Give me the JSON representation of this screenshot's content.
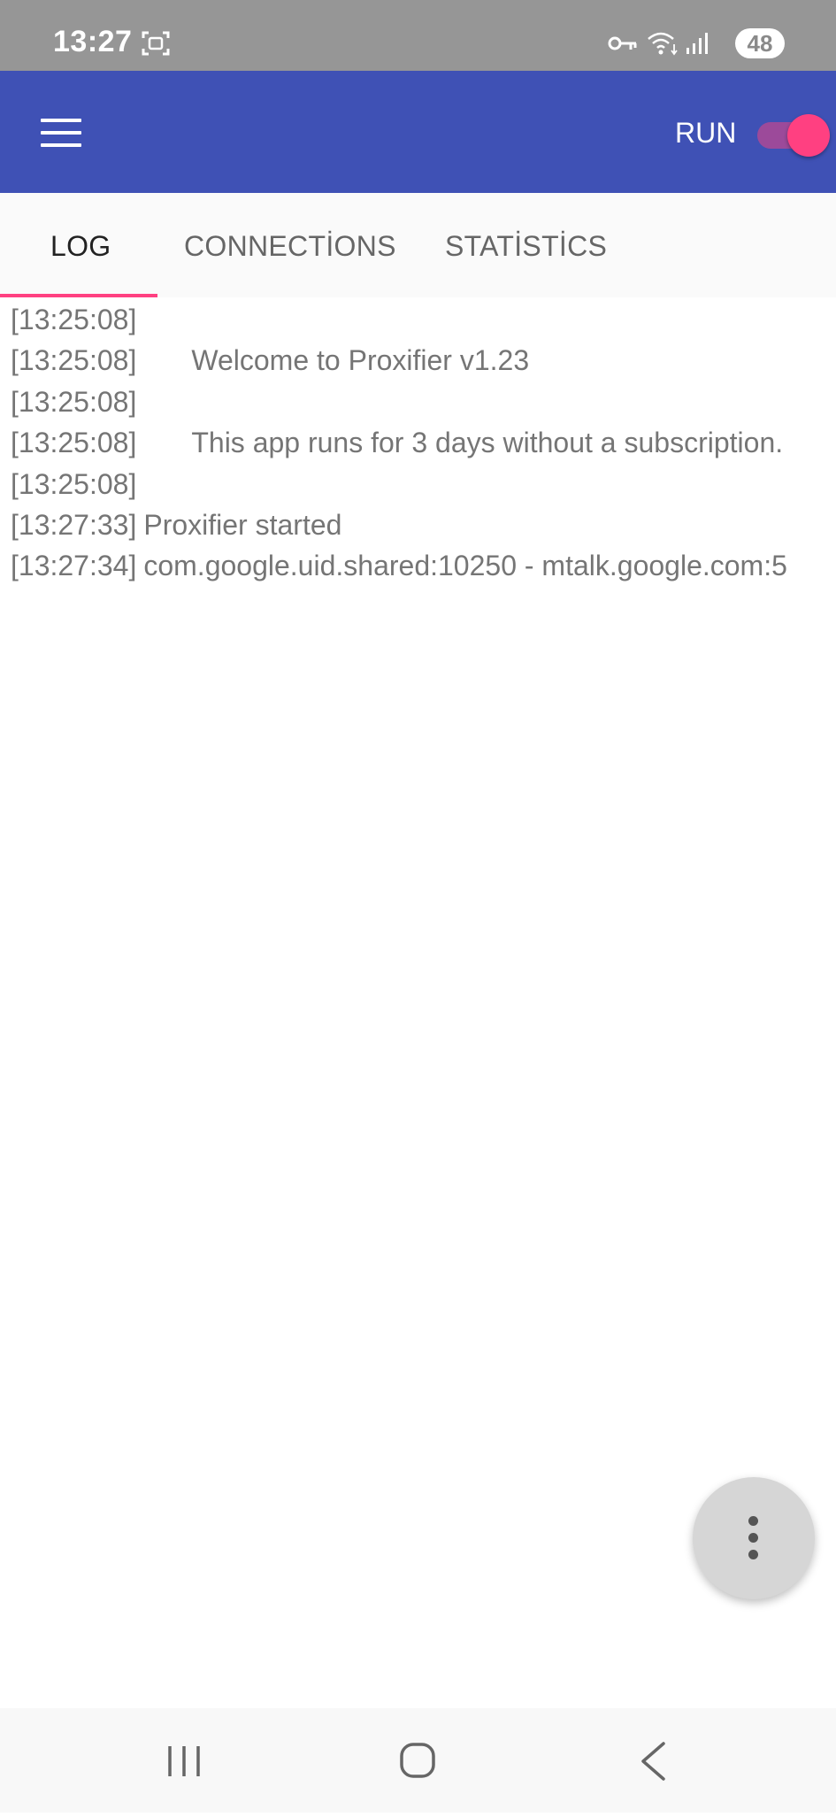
{
  "status_bar": {
    "time": "13:27",
    "battery": "48",
    "icons": [
      "screenshot-icon",
      "vpn-key-icon",
      "wifi-icon",
      "signal-icon"
    ]
  },
  "app_bar": {
    "menu_icon": "hamburger-menu-icon",
    "run_label": "RUN",
    "run_enabled": true,
    "colors": {
      "primary": "#3f51b5",
      "accent": "#ff4081"
    }
  },
  "tabs": [
    {
      "label": "LOG",
      "active": true
    },
    {
      "label": "CONNECTİONS",
      "active": false
    },
    {
      "label": "STATİSTİCS",
      "active": false
    }
  ],
  "log": [
    {
      "time": "[13:25:08]",
      "message": "",
      "indent": true
    },
    {
      "time": "[13:25:08]",
      "message": "Welcome to Proxifier v1.23",
      "indent": true
    },
    {
      "time": "[13:25:08]",
      "message": "",
      "indent": true
    },
    {
      "time": "[13:25:08]",
      "message": "This app runs for 3 days without a subscription.",
      "indent": true
    },
    {
      "time": "[13:25:08]",
      "message": "",
      "indent": true
    },
    {
      "time": "[13:27:33]",
      "message": "Proxifier started",
      "indent": false
    },
    {
      "time": "[13:27:34]",
      "message": "com.google.uid.shared:10250 - mtalk.google.com:5",
      "indent": false
    }
  ],
  "fab": {
    "icon": "more-vert-icon"
  },
  "nav_bar": {
    "buttons": [
      "recents-icon",
      "home-icon",
      "back-icon"
    ]
  }
}
